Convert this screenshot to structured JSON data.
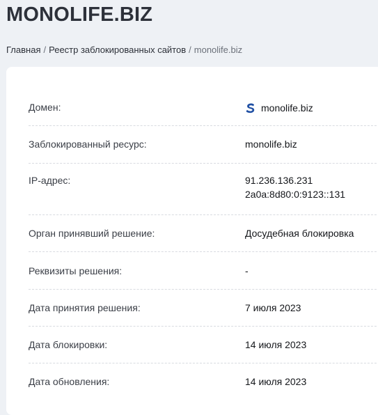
{
  "header": {
    "title": "MONOLIFE.BIZ"
  },
  "breadcrumb": {
    "items": [
      "Главная",
      "Реестр заблокированных сайтов"
    ],
    "separator": "/",
    "current": "monolife.biz"
  },
  "details": {
    "rows": [
      {
        "label": "Домен:",
        "value": "monolife.biz",
        "icon": "site-favicon-s-icon"
      },
      {
        "label": "Заблокированный ресурс:",
        "value": "monolife.biz"
      },
      {
        "label": "IP-адрес:",
        "values": [
          "91.236.136.231",
          "2a0a:8d80:0:9123::131"
        ]
      },
      {
        "label": "Орган принявший решение:",
        "value": "Досудебная блокировка"
      },
      {
        "label": "Реквизиты решения:",
        "value": "-"
      },
      {
        "label": "Дата принятия решения:",
        "value": "7 июля 2023"
      },
      {
        "label": "Дата блокировки:",
        "value": "14 июля 2023"
      },
      {
        "label": "Дата обновления:",
        "value": "14 июля 2023"
      }
    ]
  },
  "colors": {
    "background": "#eef1f5",
    "card": "#ffffff",
    "favicon_blue": "#1f4fa3"
  }
}
